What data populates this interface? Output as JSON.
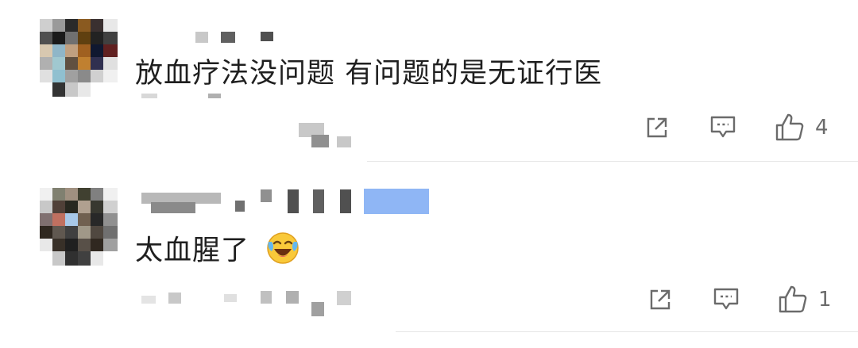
{
  "comments": [
    {
      "text": "放血疗法没问题 有问题的是无证行医",
      "likes": "4",
      "icons": {
        "share": "share-icon",
        "reply": "comment-icon",
        "like": "thumbs-up-icon"
      }
    },
    {
      "text": "太血腥了",
      "emoji": "laughing-tears-emoji",
      "likes": "1",
      "icons": {
        "share": "share-icon",
        "reply": "comment-icon",
        "like": "thumbs-up-icon"
      }
    }
  ],
  "colors": {
    "text": "#1f1f1f",
    "icon": "#6b6b6b",
    "divider": "#e6e6e6",
    "tag": "#8fb6f5"
  }
}
